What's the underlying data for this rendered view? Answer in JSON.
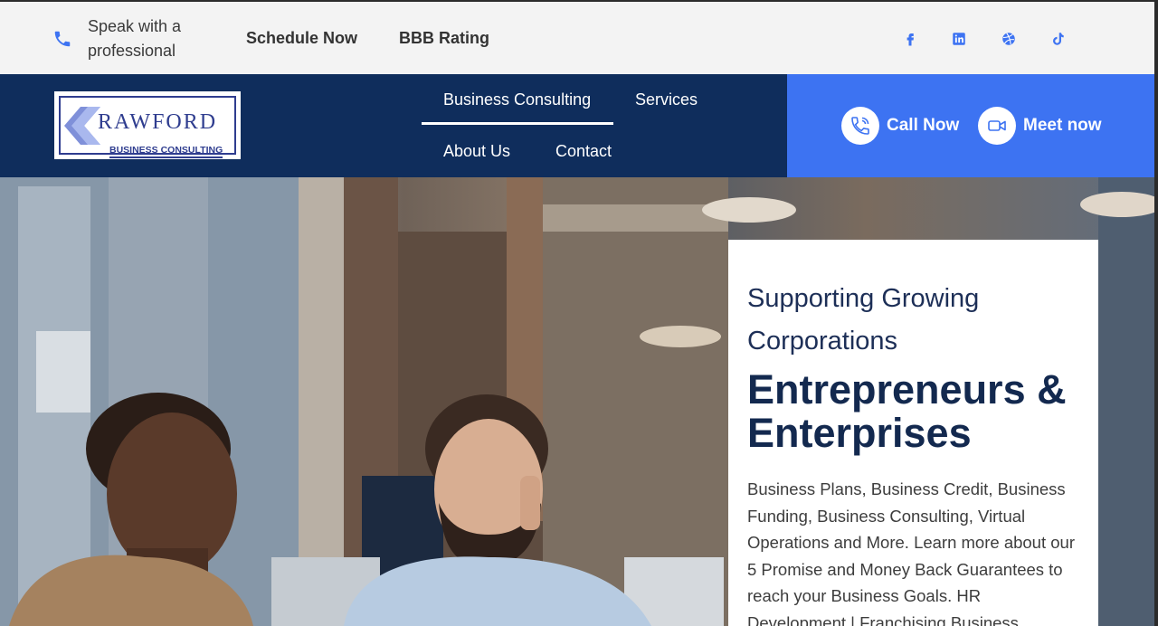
{
  "topbar": {
    "speak_text": "Speak with a professional",
    "schedule_label": "Schedule Now",
    "bbb_label": "BBB Rating",
    "icons": [
      "phone-icon",
      "facebook-icon",
      "linkedin-icon",
      "dribbble-icon",
      "tiktok-icon"
    ]
  },
  "logo": {
    "name": "RAWFORD",
    "subtitle": "BUSINESS CONSULTING"
  },
  "nav": {
    "items": [
      {
        "label": "Business Consulting",
        "active": true
      },
      {
        "label": "Services"
      },
      {
        "label": "About Us"
      },
      {
        "label": "Contact"
      }
    ]
  },
  "cta": {
    "call_label": "Call Now",
    "meet_label": "Meet now"
  },
  "hero": {
    "subtitle": "Supporting Growing Corporations",
    "title": "Entrepreneurs & Enterprises",
    "text": "Business Plans, Business Credit, Business Funding, Business Consulting, Virtual Operations and More. Learn more about our 5 Promise and Money Back Guarantees to reach your Business Goals. HR Development | Franchising Business"
  },
  "colors": {
    "navy": "#0f2d5c",
    "accent_blue": "#3d73f2",
    "topbar_bg": "#f3f3f3"
  }
}
